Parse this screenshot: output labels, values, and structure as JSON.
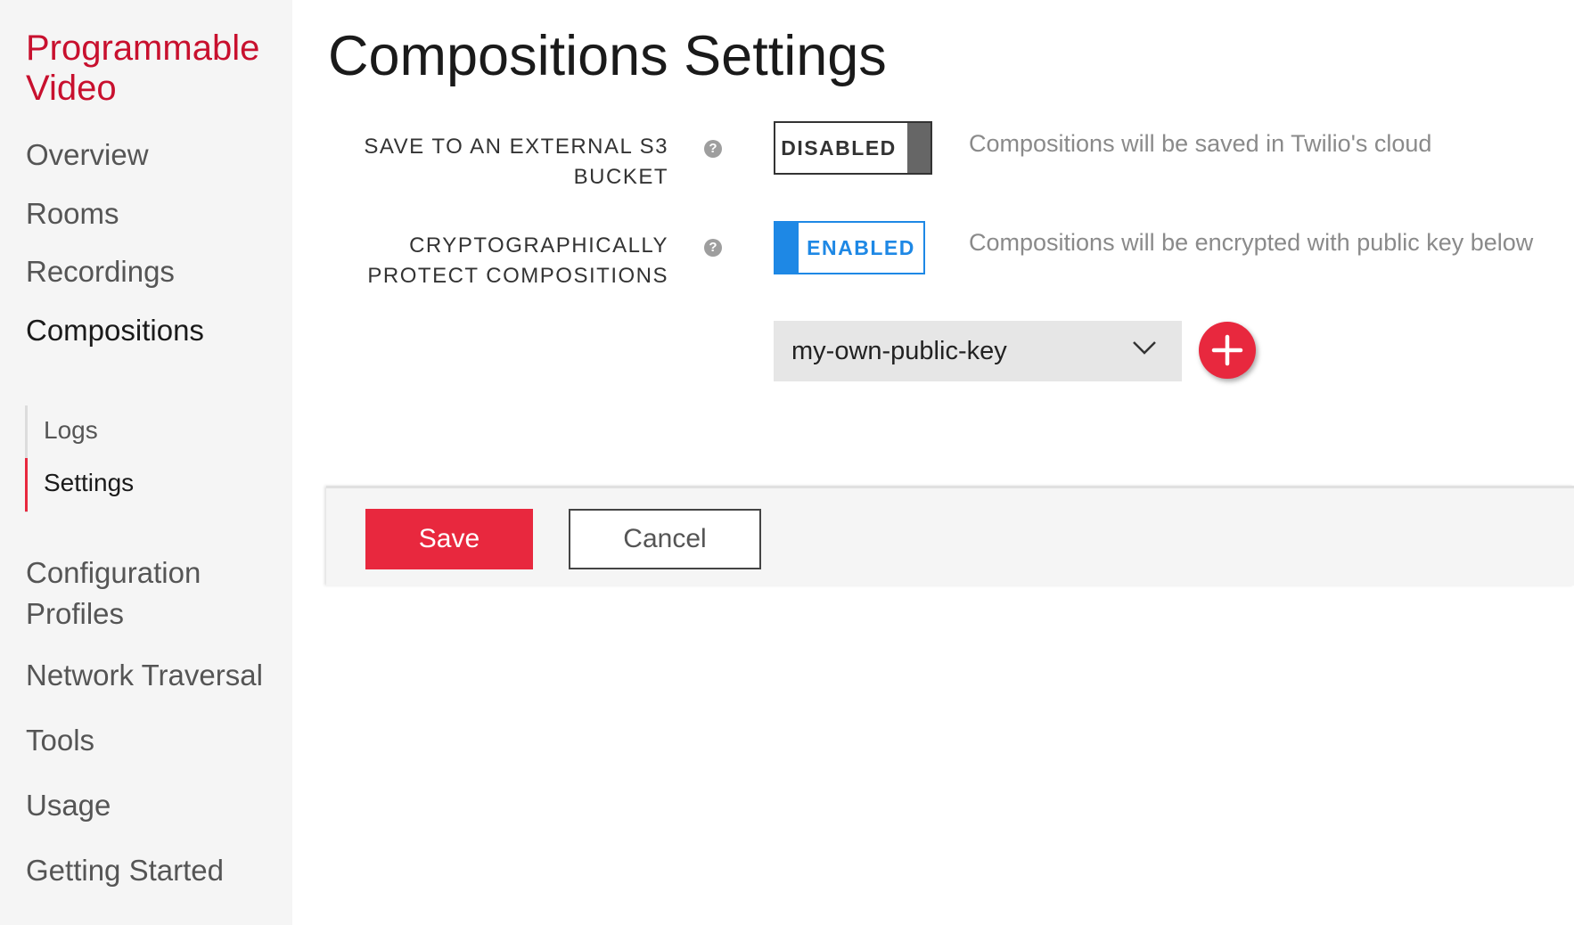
{
  "sidebar": {
    "brand_line1": "Programmable",
    "brand_line2": "Video",
    "items": [
      {
        "label": "Overview"
      },
      {
        "label": "Rooms"
      },
      {
        "label": "Recordings"
      },
      {
        "label": "Compositions"
      },
      {
        "label": "Configuration"
      },
      {
        "label": "Profiles"
      },
      {
        "label": "Network Traversal"
      },
      {
        "label": "Tools"
      },
      {
        "label": "Usage"
      },
      {
        "label": "Getting Started"
      }
    ],
    "subitems": [
      {
        "label": "Logs"
      },
      {
        "label": "Settings"
      }
    ],
    "active_item": "Compositions",
    "active_subitem": "Settings",
    "accent_color": "#e8283e"
  },
  "main": {
    "title": "Compositions Settings",
    "settings": [
      {
        "label_line1": "SAVE TO AN EXTERNAL S3",
        "label_line2": "BUCKET",
        "help_icon": "?",
        "toggle_label": "DISABLED",
        "toggle_state": "disabled",
        "description": "Compositions will be saved in Twilio's cloud"
      },
      {
        "label_line1": "CRYPTOGRAPHICALLY",
        "label_line2": "PROTECT COMPOSITIONS",
        "help_icon": "?",
        "toggle_label": "ENABLED",
        "toggle_state": "enabled",
        "description": "Compositions will be encrypted with public key below"
      }
    ],
    "public_key_select": {
      "value": "my-own-public-key",
      "icon": "chevron-down-icon"
    },
    "add_key_button": {
      "icon": "plus-icon",
      "color": "#e8283e"
    },
    "toggle_enabled_color": "#1e88e5"
  },
  "actions": {
    "save_label": "Save",
    "cancel_label": "Cancel"
  }
}
